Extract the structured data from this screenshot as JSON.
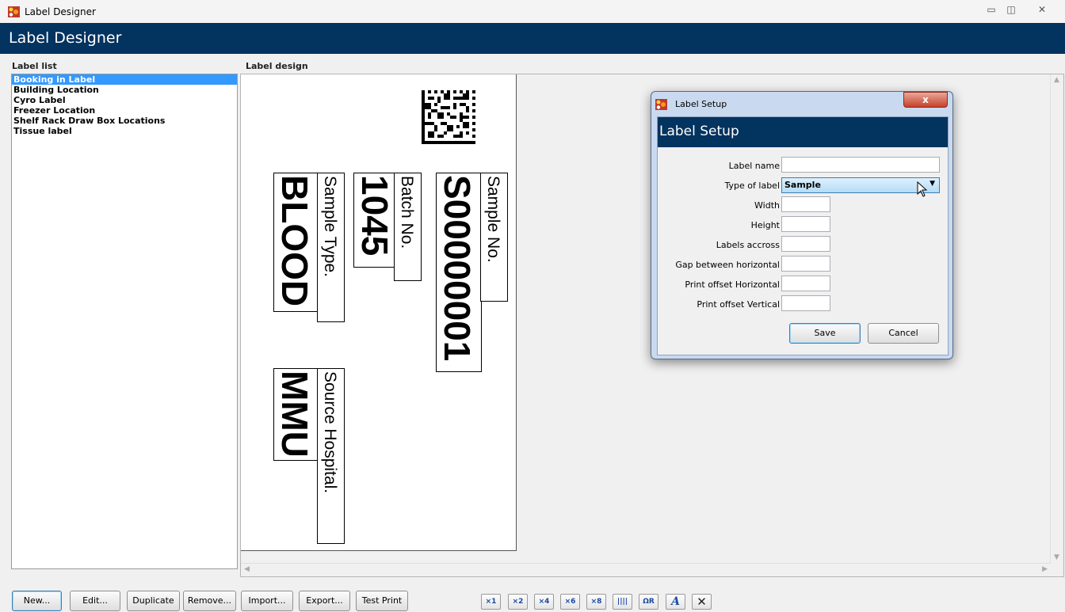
{
  "window": {
    "title": "Label Designer",
    "banner_title": "Label Designer"
  },
  "label_list": {
    "caption": "Label list",
    "items": [
      {
        "label": "Booking in Label",
        "selected": true
      },
      {
        "label": "Building Location"
      },
      {
        "label": "Cyro Label"
      },
      {
        "label": "Freezer Location"
      },
      {
        "label": "Shelf Rack Draw Box Locations"
      },
      {
        "label": "Tissue label"
      }
    ]
  },
  "label_design": {
    "caption": "Label design",
    "fields": [
      {
        "caption": "Sample Type.",
        "value": "BLOOD"
      },
      {
        "caption": "Batch No.",
        "value": "1045"
      },
      {
        "caption": "Sample No.",
        "value": "S00000001"
      },
      {
        "caption": "Source Hospital.",
        "value": "MMU"
      }
    ]
  },
  "toolbar": {
    "buttons": [
      "New...",
      "Edit...",
      "Duplicate",
      "Remove...",
      "Import...",
      "Export...",
      "Test Print"
    ],
    "tools": [
      {
        "icon": "add-field-1-icon",
        "glyph": "×1"
      },
      {
        "icon": "add-field-2-icon",
        "glyph": "×2"
      },
      {
        "icon": "add-field-4-icon",
        "glyph": "×4"
      },
      {
        "icon": "add-field-6-icon",
        "glyph": "×6"
      },
      {
        "icon": "add-field-8-icon",
        "glyph": "×8"
      },
      {
        "icon": "barcode-icon",
        "glyph": "||||"
      },
      {
        "icon": "datamatrix-icon",
        "glyph": "ΩR"
      },
      {
        "icon": "font-icon",
        "glyph": "A"
      },
      {
        "icon": "delete-icon",
        "glyph": "✕"
      }
    ]
  },
  "dialog": {
    "title": "Label Setup",
    "banner_title": "Label Setup",
    "close_glyph": "x",
    "fields": {
      "label_name": {
        "label": "Label name",
        "value": ""
      },
      "type_of_label": {
        "label": "Type of label",
        "value": "Sample"
      },
      "width": {
        "label": "Width",
        "value": ""
      },
      "height": {
        "label": "Height",
        "value": ""
      },
      "labels_across": {
        "label": "Labels accross",
        "value": ""
      },
      "gap_horizontal": {
        "label": "Gap between horizontal",
        "value": ""
      },
      "print_offset_horizontal": {
        "label": "Print offset Horizontal",
        "value": ""
      },
      "print_offset_vertical": {
        "label": "Print offset Vertical",
        "value": ""
      }
    },
    "save_label": "Save",
    "cancel_label": "Cancel"
  },
  "colors": {
    "banner": "#03335f",
    "selection": "#3399ff",
    "dialog_frame": "#c9daf0"
  }
}
